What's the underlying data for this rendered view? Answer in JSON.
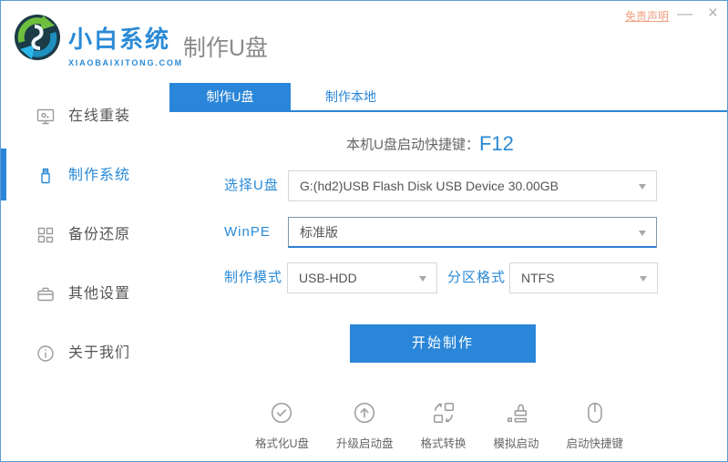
{
  "window": {
    "disclaimer": "免责声明",
    "minimize": "—",
    "close": "×"
  },
  "header": {
    "brand_name": "小白系统",
    "brand_domain": "XIAOBAIXITONG.COM",
    "page_title": "制作U盘"
  },
  "sidebar": {
    "items": [
      {
        "label": "在线重装",
        "icon": "monitor-icon",
        "active": false
      },
      {
        "label": "制作系统",
        "icon": "usb-icon",
        "active": true
      },
      {
        "label": "备份还原",
        "icon": "grid-icon",
        "active": false
      },
      {
        "label": "其他设置",
        "icon": "briefcase-icon",
        "active": false
      },
      {
        "label": "关于我们",
        "icon": "info-icon",
        "active": false
      }
    ]
  },
  "tabs": [
    {
      "label": "制作U盘",
      "active": true
    },
    {
      "label": "制作本地",
      "active": false
    }
  ],
  "main": {
    "hotkey_label": "本机U盘启动快捷键：",
    "hotkey_value": "F12",
    "form": {
      "usb_label": "选择U盘",
      "usb_value": "G:(hd2)USB Flash Disk USB Device 30.00GB",
      "winpe_label": "WinPE",
      "winpe_value": "标准版",
      "mode_label": "制作模式",
      "mode_value": "USB-HDD",
      "partition_label": "分区格式",
      "partition_value": "NTFS"
    },
    "start_button": "开始制作"
  },
  "footer": {
    "tools": [
      {
        "label": "格式化U盘",
        "icon": "check-circle-icon"
      },
      {
        "label": "升级启动盘",
        "icon": "arrow-up-circle-icon"
      },
      {
        "label": "格式转换",
        "icon": "convert-icon"
      },
      {
        "label": "模拟启动",
        "icon": "stamp-icon"
      },
      {
        "label": "启动快捷键",
        "icon": "mouse-icon"
      }
    ]
  },
  "colors": {
    "accent_blue": "#2a86d8",
    "label_blue": "#2a8ad6",
    "disclaimer_orange": "#f0a184",
    "text_gray": "#555555",
    "icon_gray": "#9b9b9b",
    "logo_green": "#6fbf3e",
    "logo_teal": "#1f8fbf"
  }
}
